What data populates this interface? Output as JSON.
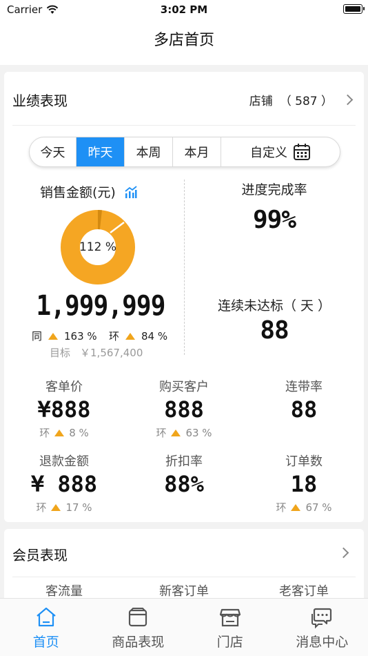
{
  "status": {
    "carrier": "Carrier",
    "time": "3:02 PM"
  },
  "nav": {
    "title": "多店首页"
  },
  "performance": {
    "title": "业绩表现",
    "store_label": "店铺",
    "store_count": "（ 587 ）",
    "segments": [
      "今天",
      "昨天",
      "本周",
      "本月",
      "自定义"
    ],
    "active_segment": "昨天",
    "sales": {
      "label": "销售金额(元)",
      "donut_percent": "112 %",
      "donut_fraction": 1.12,
      "value": "1,999,999",
      "yoy_label": "同",
      "yoy_value": "163 %",
      "mom_label": "环",
      "mom_value": "84 %",
      "target_label": "目标",
      "target_value": "￥1,567,400"
    },
    "progress": {
      "label": "进度完成率",
      "value": "99%"
    },
    "streak": {
      "label": "连续未达标（ 天 ）",
      "value": "88"
    },
    "metrics": [
      {
        "label": "客单价",
        "value": "¥888",
        "sub_label": "环",
        "sub_value": "8 %"
      },
      {
        "label": "购买客户",
        "value": "888",
        "sub_label": "环",
        "sub_value": "63 %"
      },
      {
        "label": "连带率",
        "value": "88",
        "sub_label": "",
        "sub_value": ""
      },
      {
        "label": "退款金额",
        "value": "¥ 888",
        "sub_label": "环",
        "sub_value": "17 %"
      },
      {
        "label": "折扣率",
        "value": "88%",
        "sub_label": "",
        "sub_value": ""
      },
      {
        "label": "订单数",
        "value": "18",
        "sub_label": "环",
        "sub_value": "67 %"
      }
    ]
  },
  "member": {
    "title": "会员表现",
    "columns": [
      "客流量",
      "新客订单",
      "老客订单"
    ]
  },
  "tabs": [
    {
      "label": "首页",
      "icon": "home-icon",
      "active": true
    },
    {
      "label": "商品表现",
      "icon": "product-icon",
      "active": false
    },
    {
      "label": "门店",
      "icon": "store-icon",
      "active": false
    },
    {
      "label": "消息中心",
      "icon": "message-icon",
      "active": false
    }
  ],
  "colors": {
    "accent": "#1e90f5",
    "donut": "#f5a623",
    "up_arrow": "#f0a51c"
  }
}
